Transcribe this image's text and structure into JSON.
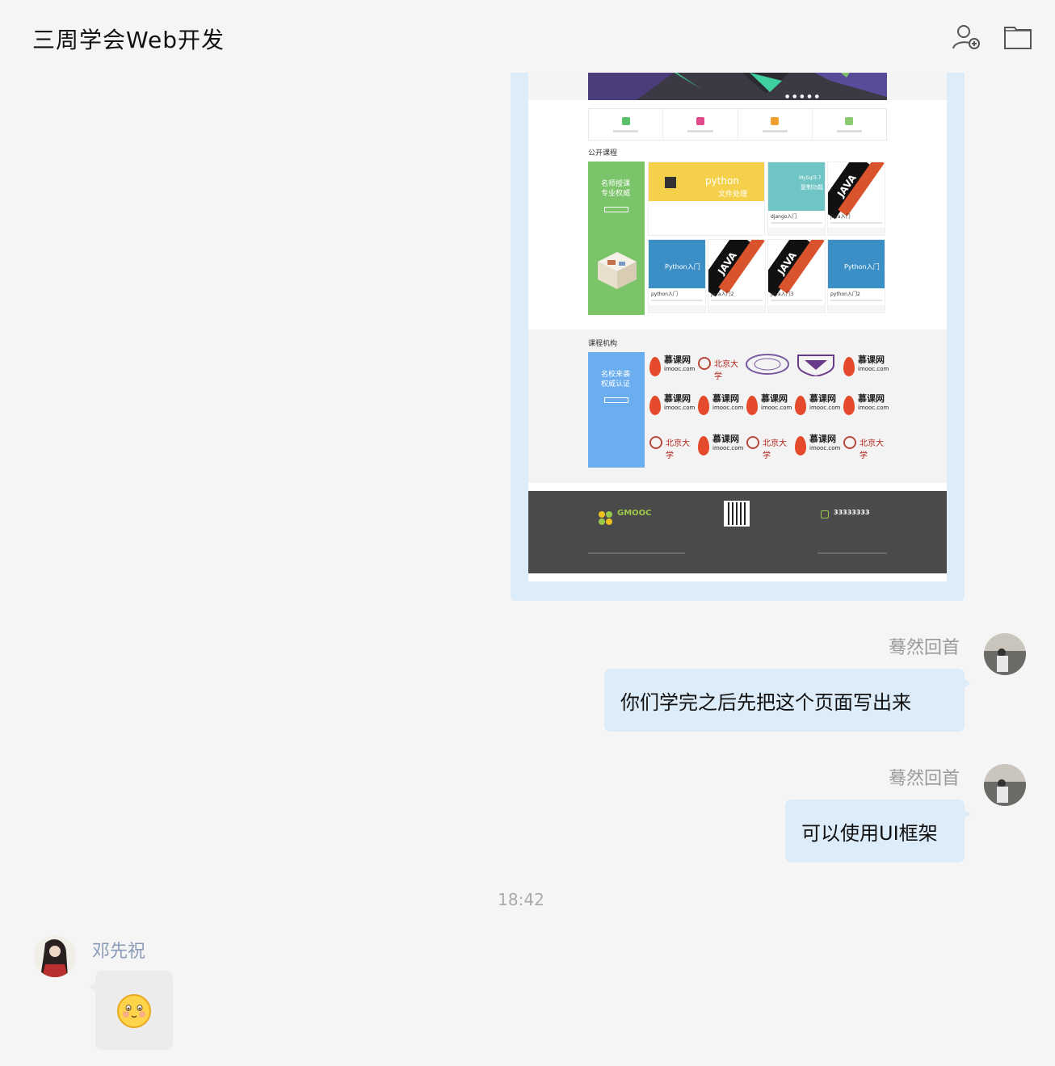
{
  "header": {
    "title": "三周学会Web开发",
    "icons": [
      "add-member-icon",
      "folder-icon"
    ]
  },
  "screenshot_preview": {
    "section_open_courses": "公开课程",
    "green_card_lines": [
      "名师授课",
      "专业权威"
    ],
    "courses_row1": [
      {
        "thumb": "python 文件处理",
        "title": ""
      },
      {
        "thumb": "MySql3.7 复制功能",
        "title": "django入门"
      },
      {
        "thumb": "JAVA",
        "title": "java入门"
      }
    ],
    "courses_row2": [
      {
        "thumb": "Python入门",
        "title": "python入门"
      },
      {
        "thumb": "JAVA",
        "title": "java入门2"
      },
      {
        "thumb": "JAVA",
        "title": "java入门3"
      },
      {
        "thumb": "Python入门",
        "title": "python入门2"
      }
    ],
    "python_banner": "python",
    "python_sub": "文件处理",
    "mysql_label": "MySql3.7",
    "mysql_sub": "复制功能",
    "section_orgs": "课程机构",
    "blue_card_lines": [
      "名校来袭",
      "权威认证"
    ],
    "imooc_name": "慕课网",
    "imooc_domain": "imooc.com",
    "pku_name": "北京大学",
    "footer_brand": "GMOOC",
    "footer_phone": "33333333"
  },
  "messages": [
    {
      "sender": "蓦然回首",
      "text": "你们学完之后先把这个页面写出来"
    },
    {
      "sender": "蓦然回首",
      "text": "可以使用UI框架"
    }
  ],
  "timestamp": "18:42",
  "reply": {
    "sender": "邓先祝",
    "content": "emoji-face-icon"
  },
  "colors": {
    "bubble_self": "#dcecf9",
    "bubble_other": "#ececec",
    "background": "#f5f5f5"
  }
}
